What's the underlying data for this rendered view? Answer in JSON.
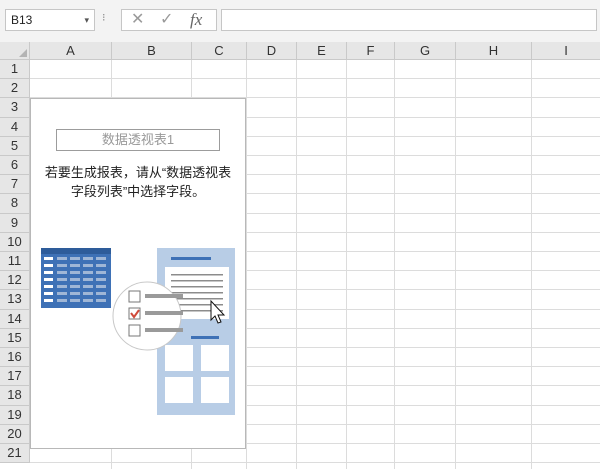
{
  "formula_bar": {
    "name_box": "B13",
    "dropdown_glyph": "▾",
    "separator_glyph": "⁝",
    "cancel_glyph": "✕",
    "enter_glyph": "✓",
    "fx_glyph": "fx",
    "formula_value": ""
  },
  "columns": [
    "A",
    "B",
    "C",
    "D",
    "E",
    "F",
    "G",
    "H",
    "I"
  ],
  "rows": [
    "1",
    "2",
    "3",
    "4",
    "5",
    "6",
    "7",
    "8",
    "9",
    "10",
    "11",
    "12",
    "13",
    "14",
    "15",
    "16",
    "17",
    "18",
    "19",
    "20",
    "21"
  ],
  "pivot": {
    "name": "数据透视表1",
    "message_line1": "若要生成报表，请从“数据透视表",
    "message_line2": "字段列表”中选择字段。"
  },
  "colors": {
    "header_bg": "#e6e6e6",
    "grid_line": "#dcdcdc",
    "illustration_blue": "#3e71b6",
    "illustration_light_blue": "#b8cde6",
    "checkmark_red": "#d04a3a"
  },
  "icons": {
    "cancel": "x-icon",
    "enter": "check-icon",
    "fx": "function-icon",
    "cursor": "mouse-pointer-icon"
  }
}
